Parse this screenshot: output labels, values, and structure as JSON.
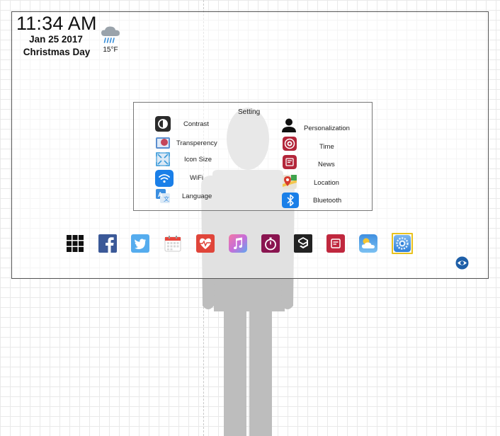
{
  "status": {
    "time": "11:34 AM",
    "date": "Jan 25 2017",
    "holiday": "Christmas Day",
    "weather": {
      "icon": "rain-cloud-icon",
      "temperature": "15°F"
    }
  },
  "settings_panel": {
    "title": "Setting",
    "left_items": [
      {
        "label": "Contrast",
        "icon": "contrast-icon",
        "color": "#2b2b2b"
      },
      {
        "label": "Transperency",
        "icon": "transparency-icon",
        "color": "#5b8fcf"
      },
      {
        "label": "Icon Size",
        "icon": "icon-size-icon",
        "color": "#3a9ad9"
      },
      {
        "label": "WiFi",
        "icon": "wifi-icon",
        "color": "#1a7fe8"
      },
      {
        "label": "Language",
        "icon": "language-icon",
        "color": "#3a8ee0"
      }
    ],
    "right_items": [
      {
        "label": "Personalization",
        "icon": "person-icon",
        "color": "#111111"
      },
      {
        "label": "Time",
        "icon": "time-icon",
        "color": "#b3263a"
      },
      {
        "label": "News",
        "icon": "news-icon",
        "color": "#b3263a"
      },
      {
        "label": "Location",
        "icon": "map-pin-icon",
        "color": "#3fa34d"
      },
      {
        "label": "Bluetooth",
        "icon": "bluetooth-icon",
        "color": "#1a7fe8"
      }
    ]
  },
  "dock": {
    "apps": [
      {
        "name": "app-grid",
        "icon": "grid-icon",
        "color": "#111111"
      },
      {
        "name": "facebook",
        "icon": "facebook-icon",
        "color": "#3b5998"
      },
      {
        "name": "twitter",
        "icon": "twitter-icon",
        "color": "#55acee"
      },
      {
        "name": "calendar",
        "icon": "calendar-icon",
        "color": "#e8463d"
      },
      {
        "name": "health",
        "icon": "heart-pulse-icon",
        "color": "#e0453a"
      },
      {
        "name": "music",
        "icon": "music-note-icon",
        "color": "#c86dd7"
      },
      {
        "name": "timer",
        "icon": "stopwatch-icon",
        "color": "#8a1550"
      },
      {
        "name": "9gag",
        "icon": "9gag-icon",
        "color": "#222222"
      },
      {
        "name": "news",
        "icon": "news-icon",
        "color": "#c0283e"
      },
      {
        "name": "weather",
        "icon": "weather-icon",
        "color": "#4ea8e6"
      },
      {
        "name": "settings",
        "icon": "settings-gear-icon",
        "color": "#2f7fd8",
        "selected_border": "#e8c21e"
      }
    ],
    "visibility_toggle": {
      "icon": "eye-icon",
      "color": "#1e5fa8"
    }
  }
}
